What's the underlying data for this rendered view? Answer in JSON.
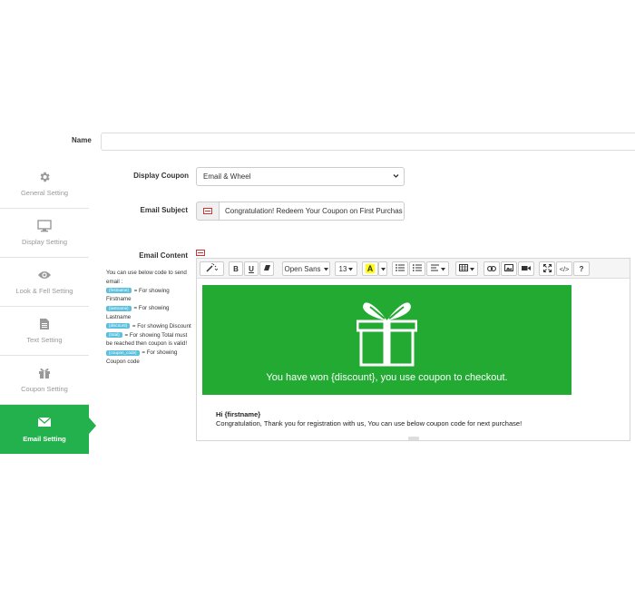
{
  "form": {
    "name_label": "Name",
    "name_value": "",
    "display_coupon_label": "Display Coupon",
    "display_coupon_value": "Email & Wheel",
    "email_subject_label": "Email Subject",
    "email_subject_value": "Congratulation! Redeem Your Coupon on First Purchas",
    "email_content_label": "Email Content"
  },
  "sidebar": {
    "items": [
      {
        "label": "General Setting",
        "icon": "gear-icon"
      },
      {
        "label": "Display Setting",
        "icon": "monitor-icon"
      },
      {
        "label": "Look & Fell Setting",
        "icon": "eye-icon"
      },
      {
        "label": "Text Setting",
        "icon": "document-icon"
      },
      {
        "label": "Coupon Setting",
        "icon": "gift-icon"
      },
      {
        "label": "Email Setting",
        "icon": "envelope-icon"
      }
    ],
    "active": "Email Setting"
  },
  "tokens": {
    "intro": "You can use below code to send email :",
    "items": [
      {
        "code": "{firstname}",
        "desc": "= For showing Firstname"
      },
      {
        "code": "{lastname}",
        "desc": "= For showing Lastname"
      },
      {
        "code": "{discount}",
        "desc": "= For showing Discount"
      },
      {
        "code": "{total}",
        "desc": "= For showing Total must be reached then coupon is valid!"
      },
      {
        "code": "{coupon_code}",
        "desc": "= For showing Coupon code"
      }
    ]
  },
  "editor": {
    "toolbar": {
      "bold": "B",
      "underline": "U",
      "font_family": "Open Sans",
      "font_size": "13",
      "color_letter": "A",
      "code_view": "</>",
      "help": "?"
    },
    "banner_text": "You have won {discount}, you use coupon to checkout.",
    "greeting": "Hi {firstname}",
    "message": "Congratulation, Thank you for registration with us, You can use below coupon code for next purchase!"
  },
  "colors": {
    "accent": "#22b14c",
    "banner": "#22aa33",
    "token_badge": "#5bc0de"
  }
}
